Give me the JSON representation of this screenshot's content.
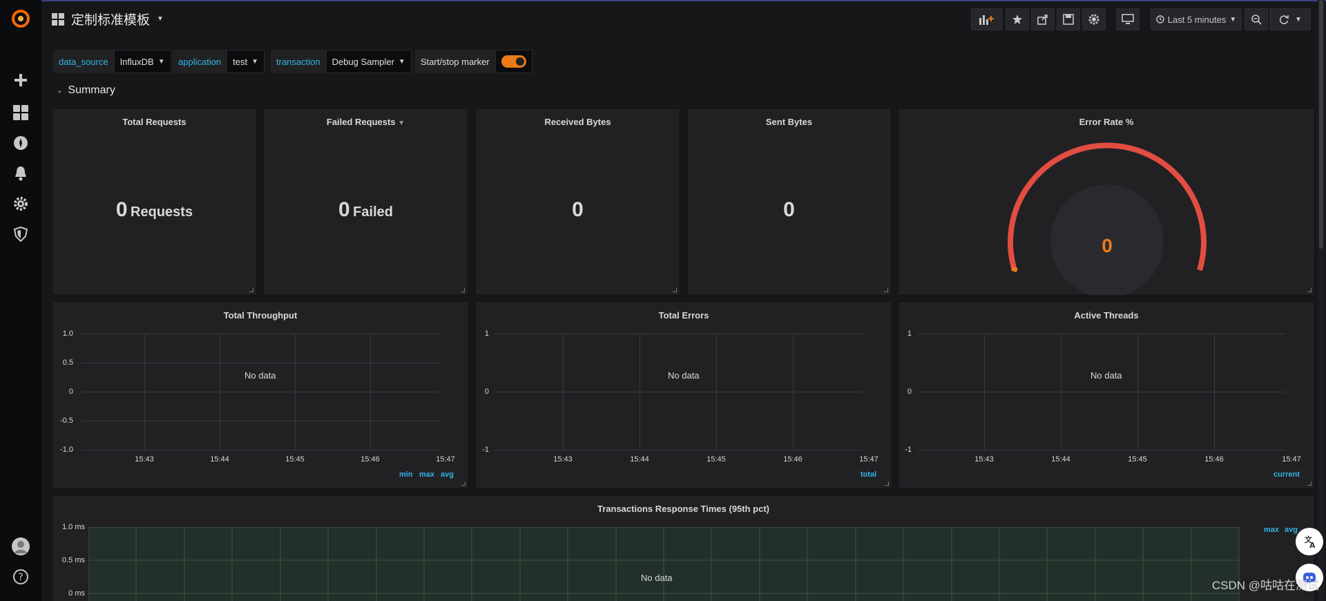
{
  "dashboard": {
    "title": "定制标准模板"
  },
  "toolbar": {
    "time_range": "Last 5 minutes"
  },
  "variables": [
    {
      "label": "data_source",
      "value": "InfluxDB"
    },
    {
      "label": "application",
      "value": "test"
    },
    {
      "label": "transaction",
      "value": "Debug Sampler"
    },
    {
      "label": "Start/stop marker",
      "toggle": true
    }
  ],
  "row": {
    "title": "Summary"
  },
  "stats": [
    {
      "title": "Total Requests",
      "value": "0",
      "unit": "Requests"
    },
    {
      "title": "Failed Requests",
      "value": "0",
      "unit": "Failed"
    },
    {
      "title": "Received Bytes",
      "value": "0",
      "unit": ""
    },
    {
      "title": "Sent Bytes",
      "value": "0",
      "unit": ""
    }
  ],
  "gauge": {
    "title": "Error Rate %",
    "value": "0",
    "color": "#e24d42",
    "value_color": "#eb7b18"
  },
  "graphs": [
    {
      "title": "Total Throughput",
      "no_data": "No data",
      "yticks": [
        "1.0",
        "0.5",
        "0",
        "-0.5",
        "-1.0"
      ],
      "xticks": [
        "15:43",
        "15:44",
        "15:45",
        "15:46",
        "15:47"
      ],
      "legend": [
        "min",
        "max",
        "avg"
      ]
    },
    {
      "title": "Total Errors",
      "no_data": "No data",
      "yticks": [
        "1",
        "0",
        "-1"
      ],
      "xticks": [
        "15:43",
        "15:44",
        "15:45",
        "15:46",
        "15:47"
      ],
      "legend": [
        "total"
      ]
    },
    {
      "title": "Active Threads",
      "no_data": "No data",
      "yticks": [
        "1",
        "0",
        "-1"
      ],
      "xticks": [
        "15:43",
        "15:44",
        "15:45",
        "15:46",
        "15:47"
      ],
      "legend": [
        "current"
      ]
    }
  ],
  "response_times": {
    "title": "Transactions Response Times (95th pct)",
    "no_data": "No data",
    "yticks": [
      "1.0 ms",
      "0.5 ms",
      "0 ms"
    ],
    "legend": [
      "max",
      "avg"
    ]
  },
  "watermark": "CSDN @咕咕在测试",
  "colors": {
    "accent": "#33b5e5",
    "orange": "#eb7b18",
    "red": "#e24d42",
    "bg": "#161719",
    "panel": "#212124"
  }
}
